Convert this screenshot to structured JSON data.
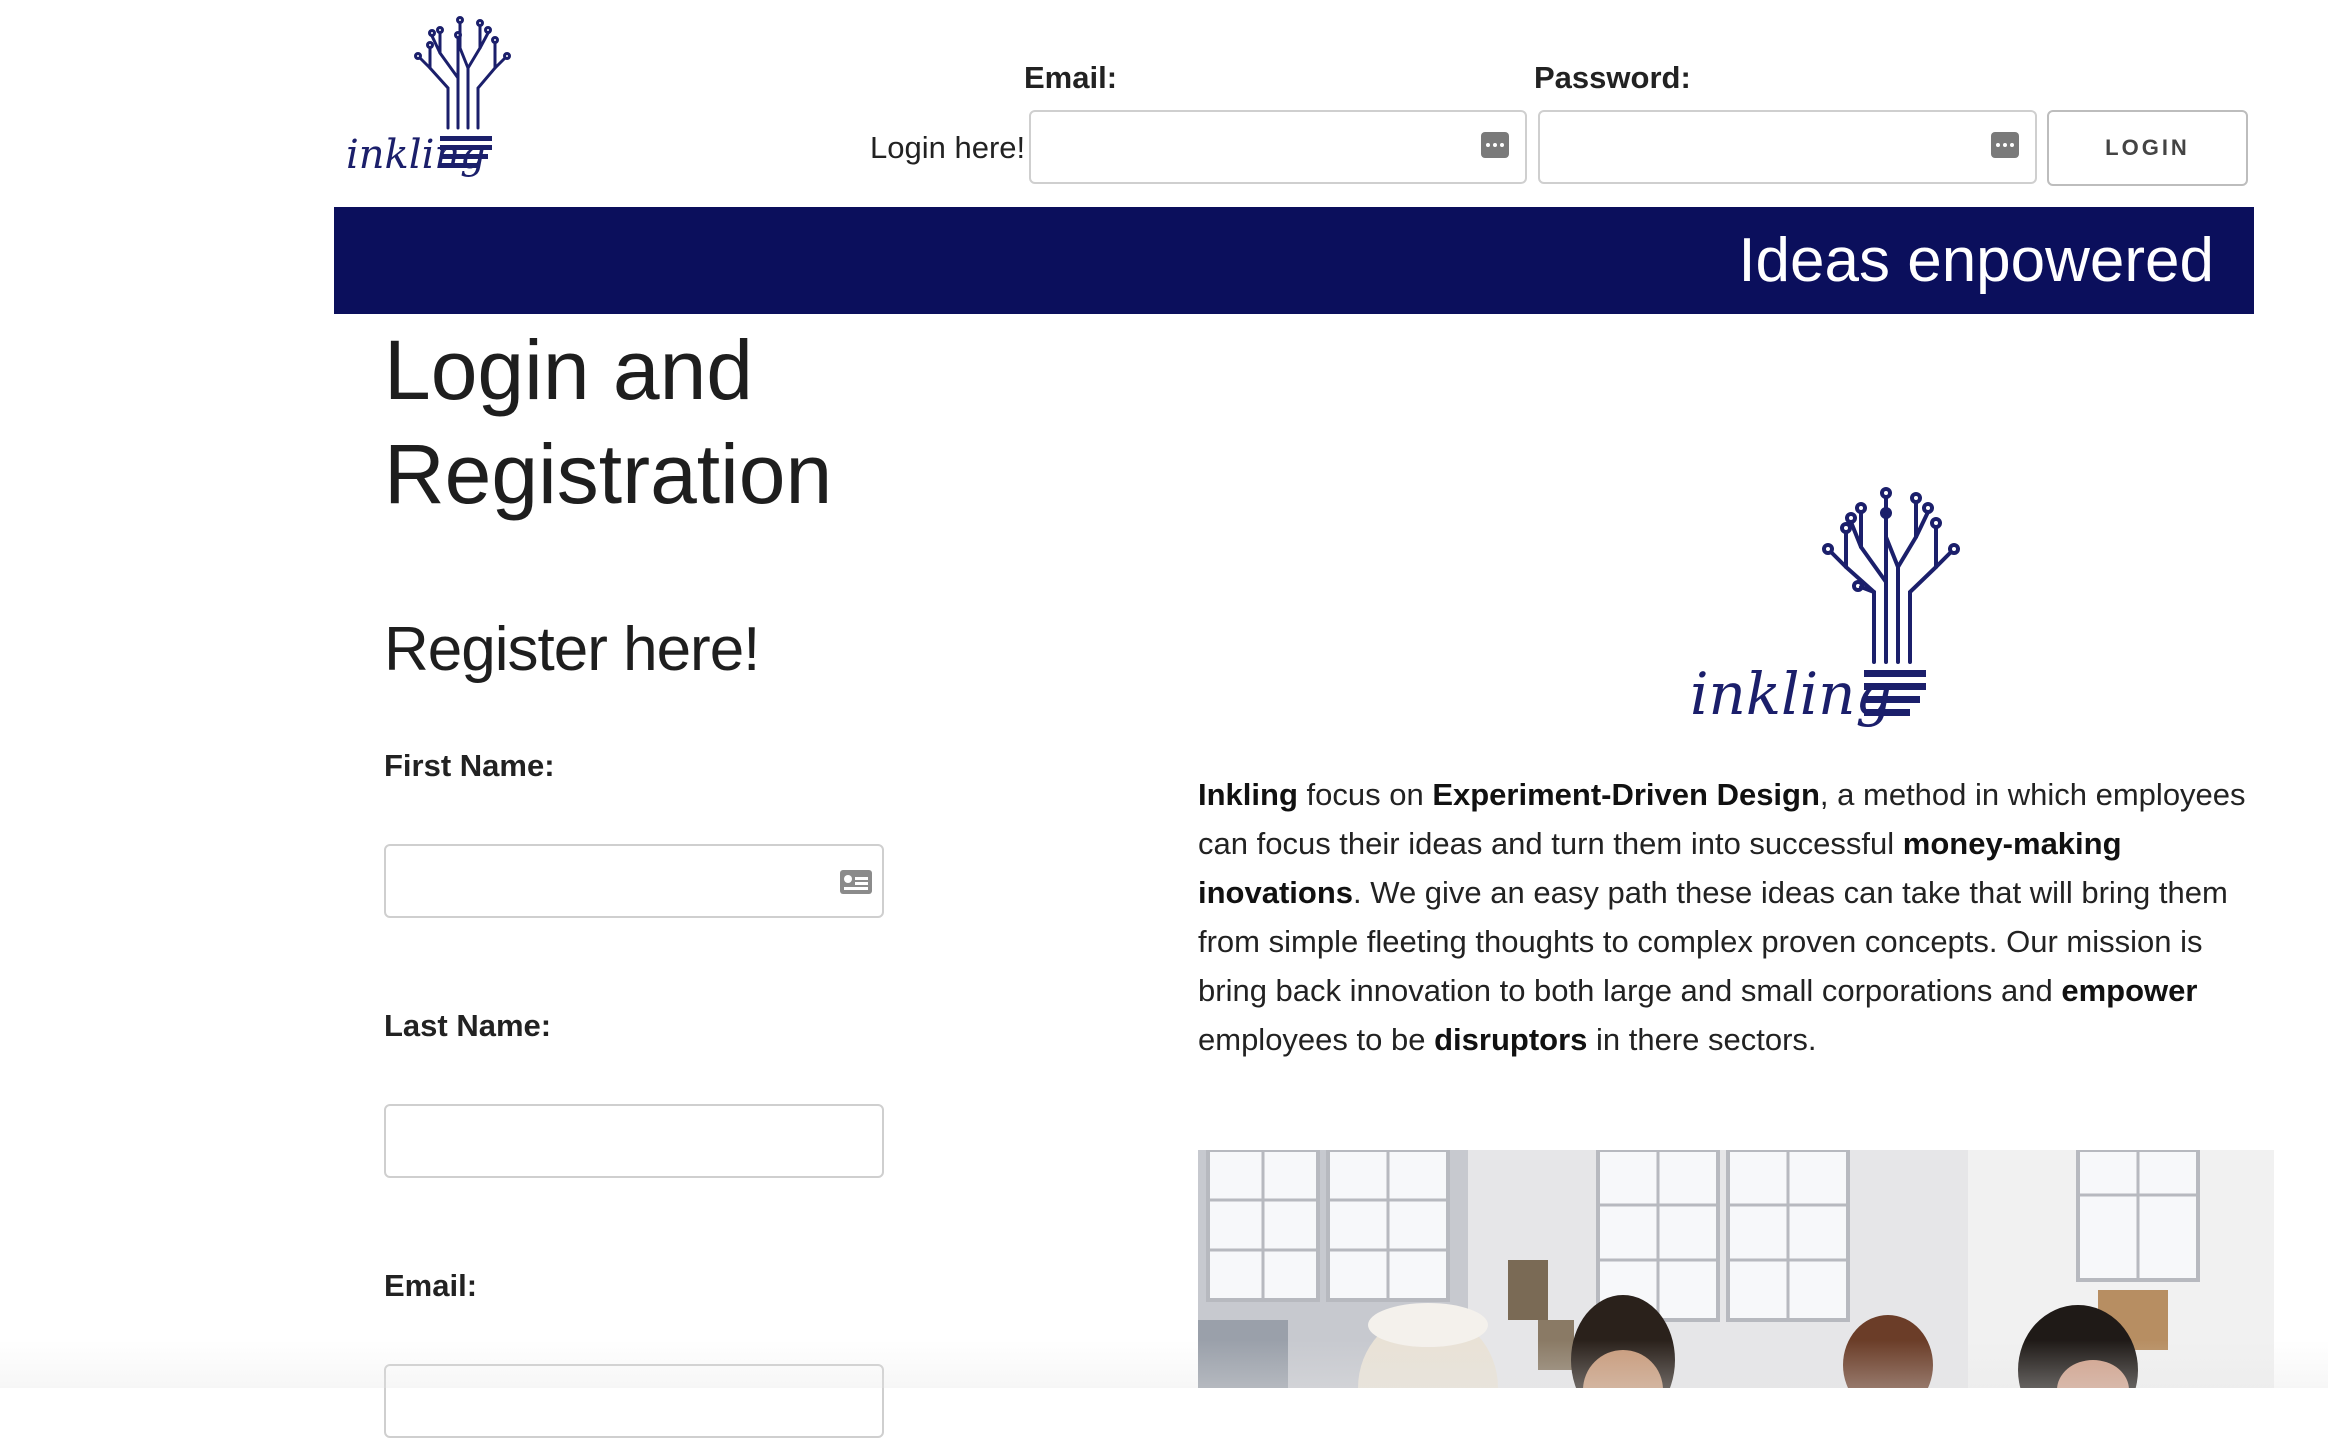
{
  "brand": {
    "logo_text": "inkling",
    "tagline": "Ideas enpowered",
    "colors": {
      "navy": "#0b0f5c",
      "logo": "#1b1f6b"
    }
  },
  "login": {
    "intro": "Login here!",
    "email_label": "Email:",
    "password_label": "Password:",
    "email_value": "",
    "password_value": "",
    "button_label": "LOGIN"
  },
  "page": {
    "title": "Login and Registration"
  },
  "register": {
    "heading": "Register here!",
    "first_name_label": "First Name:",
    "last_name_label": "Last Name:",
    "email_label": "Email:",
    "first_name_value": "",
    "last_name_value": "",
    "email_value": ""
  },
  "about": {
    "p1_b1": "Inkling",
    "p1_t1": " focus on ",
    "p1_b2": "Experiment-Driven Design",
    "p1_t2": ", a method in which employees can focus their ideas and turn them into successful ",
    "p1_b3": "money-making inovations",
    "p1_t3": ". We give an easy path these ideas can take that will bring them from simple fleeting thoughts to complex proven concepts. Our mission is bring back innovation to both large and small corporations and ",
    "p1_b4": "empower",
    "p1_t4": " employees to be ",
    "p1_b5": "disruptors",
    "p1_t5": " in there sectors."
  },
  "icons": {
    "password_manager": "key-dots-icon",
    "contact_card": "contact-card-icon"
  }
}
